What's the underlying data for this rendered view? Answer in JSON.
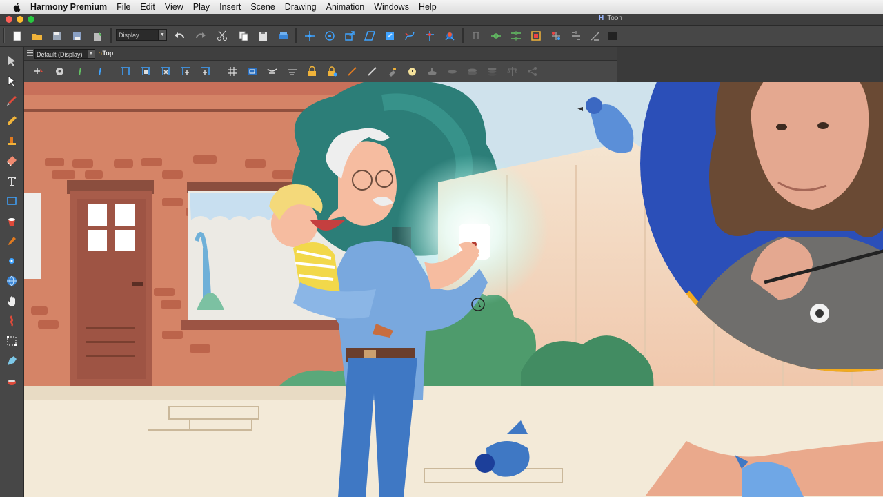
{
  "menubar": {
    "app_name": "Harmony Premium",
    "menus": [
      "File",
      "Edit",
      "View",
      "Play",
      "Insert",
      "Scene",
      "Drawing",
      "Animation",
      "Windows",
      "Help"
    ]
  },
  "window": {
    "title_fragment": "Toon",
    "title_icon": "H"
  },
  "toolbar": {
    "display_select": "Display",
    "icons": [
      "new-scene-icon",
      "open-scene-icon",
      "save-icon",
      "save-as-icon",
      "save-drawing-icon",
      "undo-icon",
      "redo-icon",
      "cut-icon",
      "copy-icon",
      "paste-icon",
      "delete-icon",
      "transform-icon",
      "rotate-icon",
      "scale-icon",
      "skew-icon",
      "maximize-icon",
      "spline-offset-icon",
      "bone-icon",
      "kinematic-icon",
      "morph-icon",
      "hierarchy-icon",
      "pin-icon",
      "peg-icon",
      "deformer-icon",
      "envelope-icon"
    ]
  },
  "view": {
    "view_select": "Default (Display)",
    "view_mode": "Top"
  },
  "colors": {
    "accent_yellow": "#f2aa1e",
    "ui_dark": "#474747",
    "webcam_blue": "#2b4fb8",
    "wall_brick": "#d58467",
    "fence": "#f4e2cc",
    "tree_teal": "#2c7e78",
    "sidewalk": "#f3ead8"
  }
}
